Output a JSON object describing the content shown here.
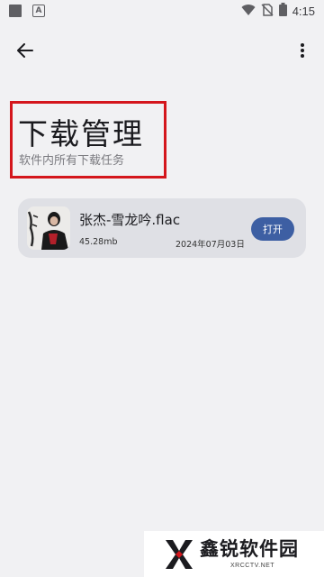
{
  "status_bar": {
    "time": "4:15",
    "notification_letter": "A"
  },
  "toolbar": {
    "back_icon": "arrow-left-icon",
    "more_icon": "more-vert-icon"
  },
  "header": {
    "title": "下载管理",
    "subtitle": "软件内所有下载任务"
  },
  "downloads": [
    {
      "file_name": "张杰-雪龙吟.flac",
      "size": "45.28mb",
      "date": "2024年07月03日",
      "action_label": "打开"
    }
  ],
  "watermark": {
    "brand": "鑫锐软件园",
    "site": "XRCCTV.NET"
  },
  "colors": {
    "background": "#f1f1f3",
    "card": "#dfe0e5",
    "button": "#3d5fa3",
    "highlight_box": "#d4161c"
  }
}
